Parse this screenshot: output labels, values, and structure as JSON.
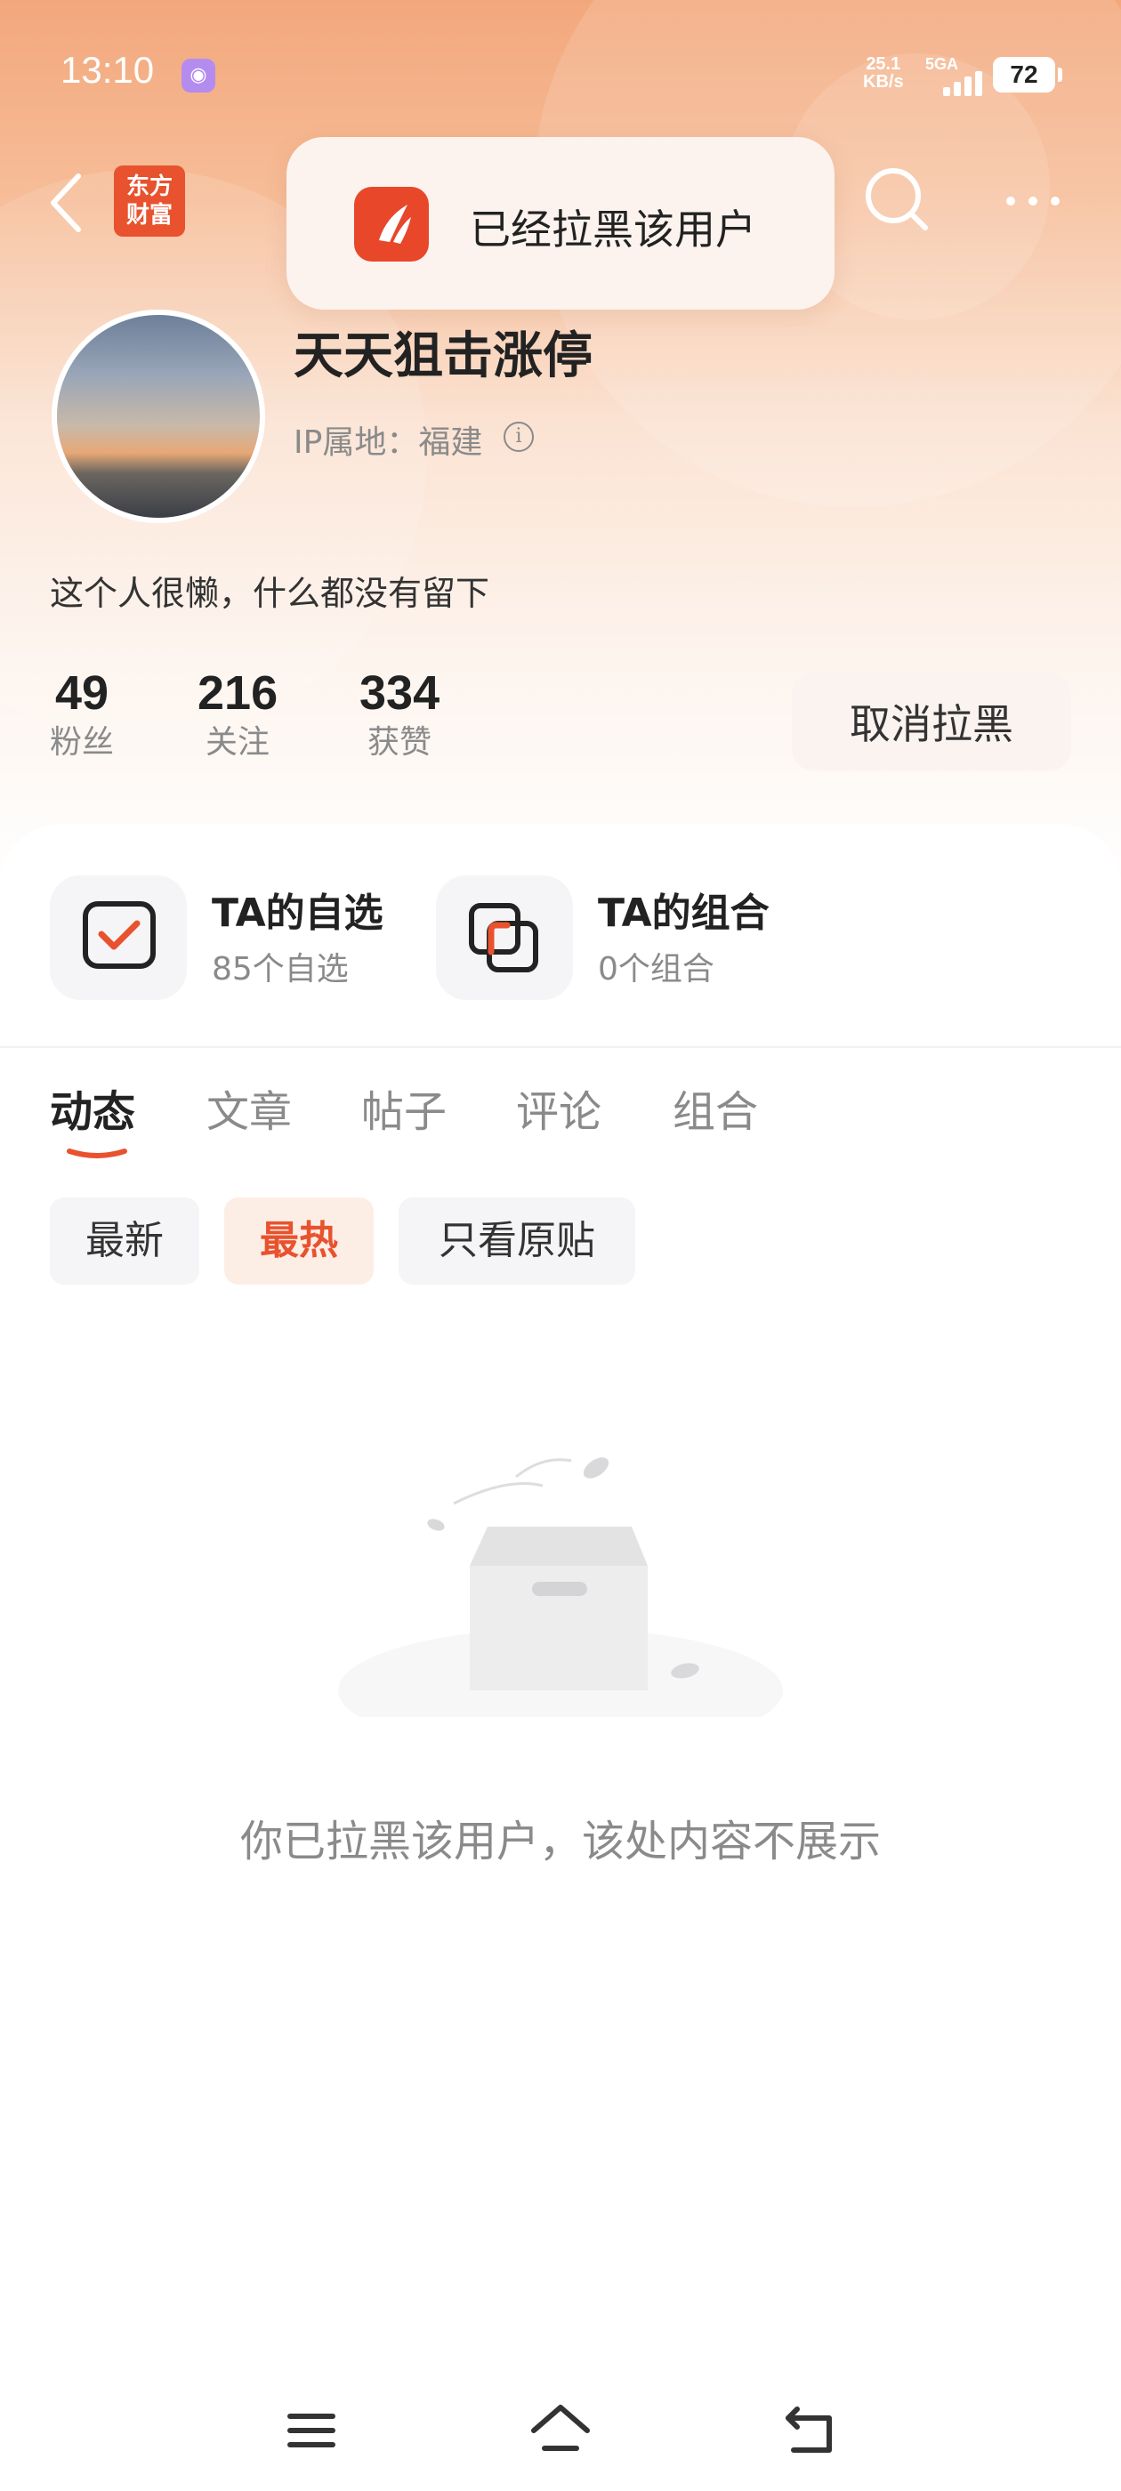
{
  "status_bar": {
    "time": "13:10",
    "net_speed_value": "25.1",
    "net_speed_unit": "KB/s",
    "network": "5GA",
    "battery": "72"
  },
  "top_bar": {
    "app_logo_line1": "东方",
    "app_logo_line2": "财富"
  },
  "toast": {
    "text": "已经拉黑该用户"
  },
  "profile": {
    "username": "天天狙击涨停",
    "ip_location": "IP属地：福建",
    "bio": "这个人很懒，什么都没有留下",
    "stats": [
      {
        "value": "49",
        "label": "粉丝"
      },
      {
        "value": "216",
        "label": "关注"
      },
      {
        "value": "334",
        "label": "获赞"
      }
    ],
    "unblock_button": "取消拉黑"
  },
  "shortcuts": [
    {
      "title": "TA的自选",
      "subtitle": "85个自选"
    },
    {
      "title": "TA的组合",
      "subtitle": "0个组合"
    }
  ],
  "tabs": [
    {
      "label": "动态"
    },
    {
      "label": "文章"
    },
    {
      "label": "帖子"
    },
    {
      "label": "评论"
    },
    {
      "label": "组合"
    }
  ],
  "active_tab": "动态",
  "filters": [
    {
      "label": "最新"
    },
    {
      "label": "最热"
    },
    {
      "label": "只看原贴"
    }
  ],
  "active_filter": "最热",
  "empty_state": {
    "text": "你已拉黑该用户，该处内容不展示"
  },
  "colors": {
    "accent": "#e8522e",
    "header_top": "#f3a77c"
  }
}
